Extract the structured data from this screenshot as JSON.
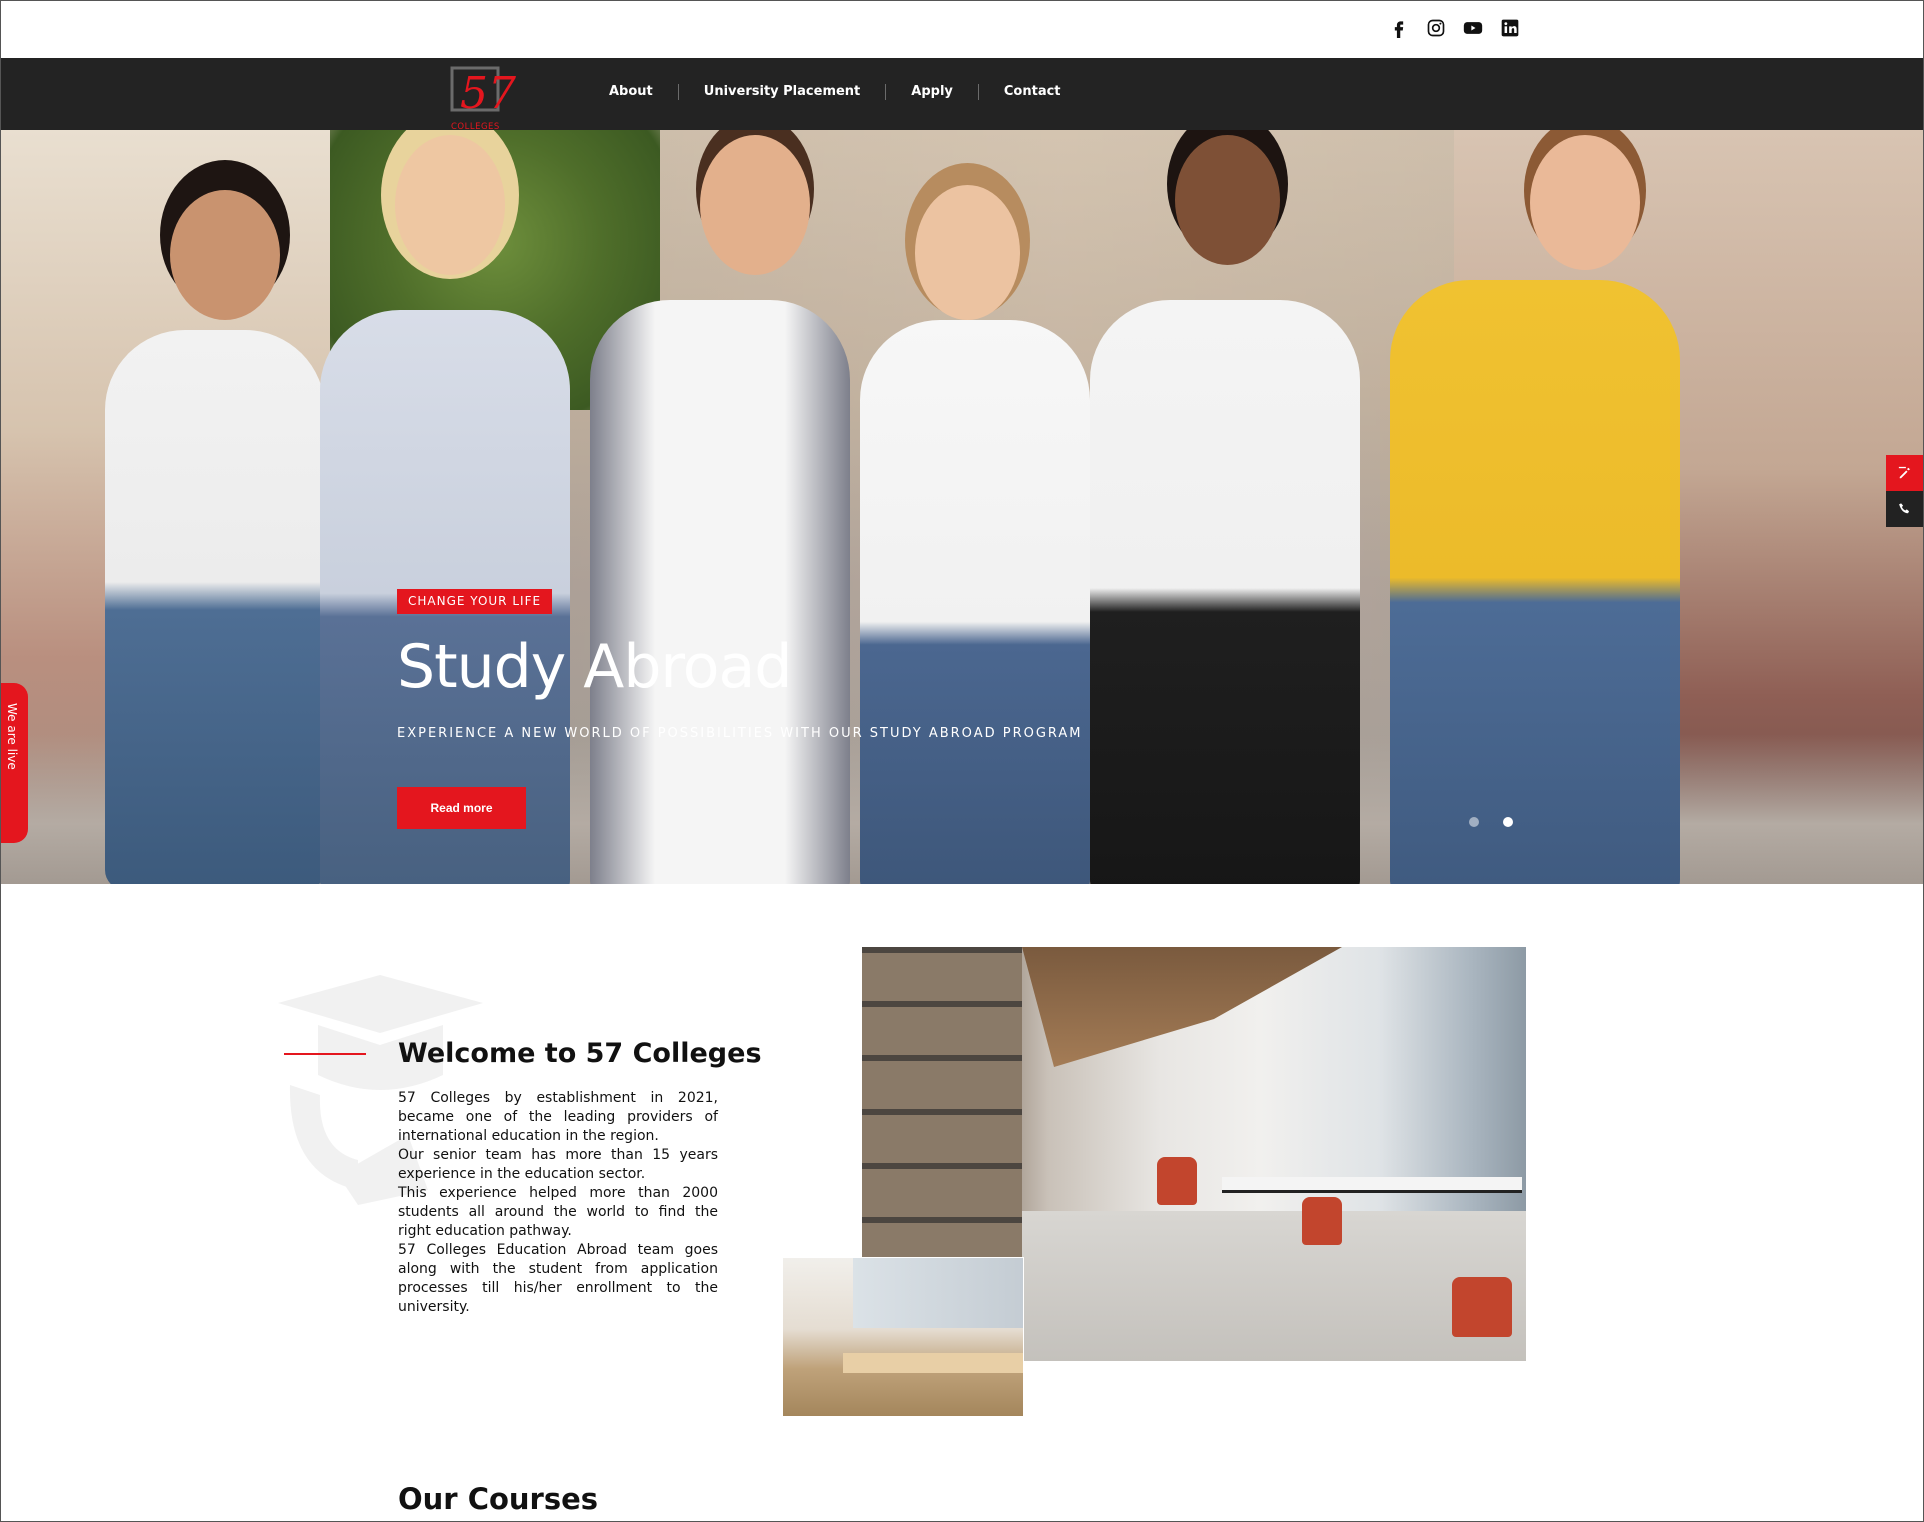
{
  "social": {
    "icons": [
      "facebook-icon",
      "instagram-icon",
      "youtube-icon",
      "linkedin-icon"
    ]
  },
  "logo": {
    "number": "57",
    "word": "COLLEGES"
  },
  "nav": {
    "items": [
      {
        "label": "About"
      },
      {
        "label": "University Placement"
      },
      {
        "label": "Apply"
      },
      {
        "label": "Contact"
      }
    ]
  },
  "hero": {
    "tag": "CHANGE YOUR LIFE",
    "title": "Study Abroad",
    "subtitle": "EXPERIENCE A NEW WORLD OF POSSIBILITIES WITH OUR STUDY ABROAD PROGRAM",
    "button": "Read more",
    "slides": 2,
    "active_slide": 2
  },
  "side_widget": {
    "live_label": "We are live",
    "buttons": [
      "edit-icon",
      "phone-icon"
    ]
  },
  "welcome": {
    "title": "Welcome to 57 Colleges",
    "paragraphs": [
      "57 Colleges by establishment in 2021, became one of the leading providers of international education in the region.",
      "Our senior team has more than 15 years experience in the education sector.",
      "This experience helped more than 2000 students all around the world to find the right education pathway.",
      "57 Colleges Education Abroad team goes along with the student from application processes till his/her enrollment to the university."
    ]
  },
  "courses": {
    "title": "Our Courses"
  },
  "colors": {
    "accent": "#e4161e",
    "nav_bg": "#232323",
    "text": "#111111"
  }
}
